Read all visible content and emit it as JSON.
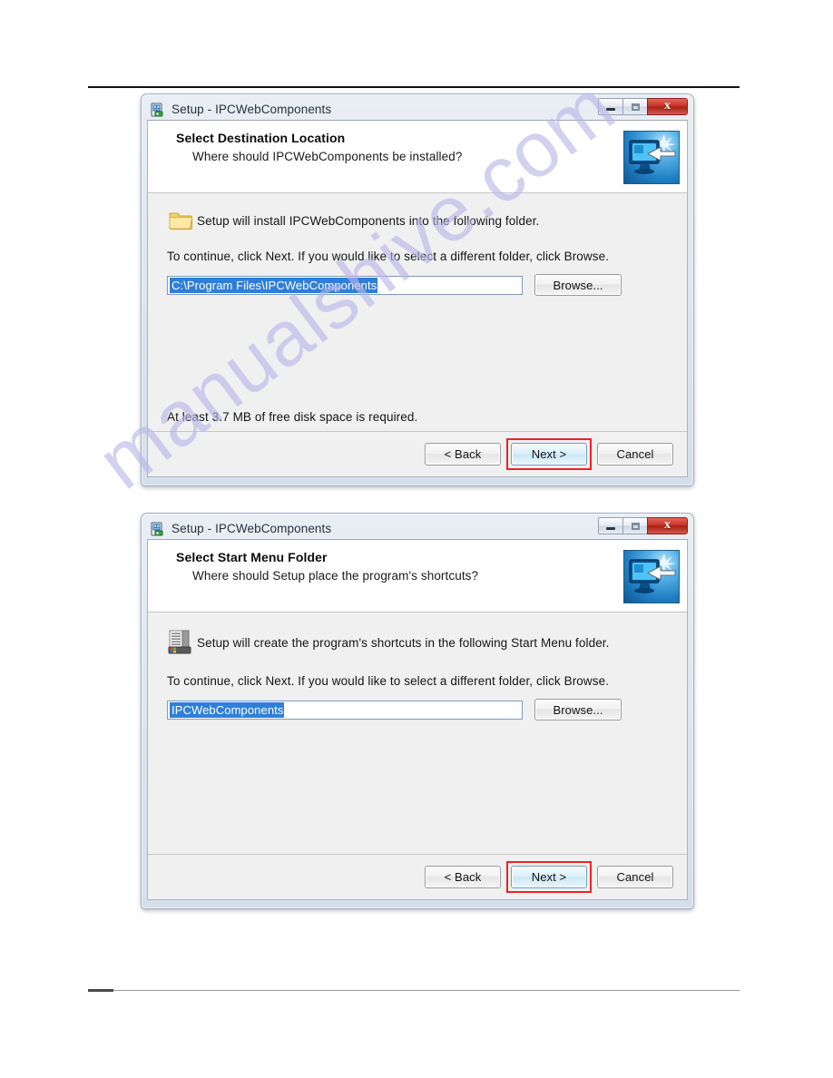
{
  "page": {
    "watermark": "manualshive.com"
  },
  "dialogs": [
    {
      "id": "destination",
      "titlebar": {
        "title": "Setup - IPCWebComponents",
        "icon": "setup-installer-icon",
        "minimize_label": "",
        "maximize_label": "",
        "close_label": "x"
      },
      "header": {
        "heading": "Select Destination Location",
        "subheading": "Where should IPCWebComponents be installed?",
        "banner_icon": "monitor-install-arrow-icon"
      },
      "body": {
        "icon": "folder-icon",
        "intro": "Setup will install IPCWebComponents into the following folder.",
        "instruction": "To continue, click Next. If you would like to select a different folder, click Browse.",
        "field_value": "C:\\Program Files\\IPCWebComponents",
        "field_selected": true,
        "browse_label": "Browse...",
        "note": "At least 3.7 MB of free disk space is required."
      },
      "footer": {
        "back_label": "< Back",
        "next_label": "Next >",
        "cancel_label": "Cancel",
        "next_highlighted": true
      }
    },
    {
      "id": "startmenu",
      "titlebar": {
        "title": "Setup - IPCWebComponents",
        "icon": "setup-installer-icon",
        "minimize_label": "",
        "maximize_label": "",
        "close_label": "x"
      },
      "header": {
        "heading": "Select Start Menu Folder",
        "subheading": "Where should Setup place the program's shortcuts?",
        "banner_icon": "monitor-install-arrow-icon"
      },
      "body": {
        "icon": "start-menu-icon",
        "intro": "Setup will create the program's shortcuts in the following Start Menu folder.",
        "instruction": "To continue, click Next. If you would like to select a different folder, click Browse.",
        "field_value": "IPCWebComponents",
        "field_selected": true,
        "browse_label": "Browse...",
        "note": "",
        "highlight_color": "#ee2222"
      },
      "footer": {
        "back_label": "< Back",
        "next_label": "Next >",
        "cancel_label": "Cancel",
        "next_highlighted": true
      }
    }
  ],
  "colors": {
    "selection_blue": "#2f7fd8",
    "highlight_red": "#ee2222",
    "window_chrome": "#dfe7f0",
    "client_bg": "#f0f0f0",
    "watermark_purple": "#b9b6e8"
  }
}
